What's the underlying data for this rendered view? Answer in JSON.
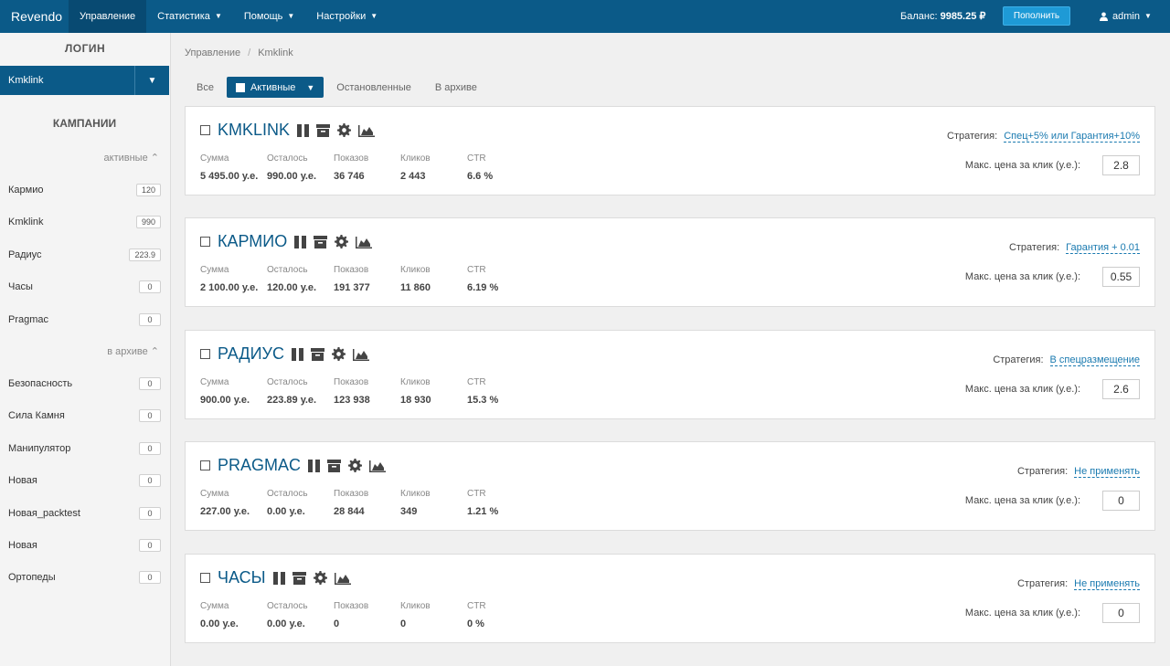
{
  "topbar": {
    "brand": "Revendo",
    "nav": [
      "Управление",
      "Статистика",
      "Помощь",
      "Настройки"
    ],
    "balance_label": "Баланс:",
    "balance_value": "9985.25 ₽",
    "topup_label": "Пополнить",
    "user": "admin"
  },
  "sidebar": {
    "login_heading": "ЛОГИН",
    "login_value": "Kmklink",
    "campaigns_heading": "КАМПАНИИ",
    "active_label": "активные",
    "archive_label": "в архиве",
    "active_items": [
      {
        "name": "Кармио",
        "count": "120"
      },
      {
        "name": "Kmklink",
        "count": "990"
      },
      {
        "name": "Радиус",
        "count": "223.9"
      },
      {
        "name": "Часы",
        "count": "0"
      },
      {
        "name": "Pragmac",
        "count": "0"
      }
    ],
    "archive_items": [
      {
        "name": "Безопасность",
        "count": "0"
      },
      {
        "name": "Сила Камня",
        "count": "0"
      },
      {
        "name": "Манипулятор",
        "count": "0"
      },
      {
        "name": "Новая",
        "count": "0"
      },
      {
        "name": "Новая_packtest",
        "count": "0"
      },
      {
        "name": "Новая",
        "count": "0"
      },
      {
        "name": "Ортопеды",
        "count": "0"
      }
    ]
  },
  "breadcrumb": [
    "Управление",
    "Kmklink"
  ],
  "filters": {
    "all": "Все",
    "active": "Активные",
    "stopped": "Остановленные",
    "archive": "В архиве"
  },
  "stat_labels": [
    "Сумма",
    "Осталось",
    "Показов",
    "Кликов",
    "CTR"
  ],
  "strategy_label": "Стратегия:",
  "maxprice_label": "Макс. цена за клик (у.е.):",
  "campaigns": [
    {
      "name": "KMKLINK",
      "stats": [
        "5 495.00 у.е.",
        "990.00 у.е.",
        "36 746",
        "2 443",
        "6.6 %"
      ],
      "strategy": "Спец+5% или Гарантия+10%",
      "price": "2.8"
    },
    {
      "name": "КАРМИО",
      "stats": [
        "2 100.00 у.е.",
        "120.00 у.е.",
        "191 377",
        "11 860",
        "6.19 %"
      ],
      "strategy": "Гарантия + 0.01",
      "price": "0.55"
    },
    {
      "name": "РАДИУС",
      "stats": [
        "900.00 у.е.",
        "223.89 у.е.",
        "123 938",
        "18 930",
        "15.3 %"
      ],
      "strategy": "В спецразмещение",
      "price": "2.6"
    },
    {
      "name": "PRAGMAC",
      "stats": [
        "227.00 у.е.",
        "0.00 у.е.",
        "28 844",
        "349",
        "1.21 %"
      ],
      "strategy": "Не применять",
      "price": "0"
    },
    {
      "name": "ЧАСЫ",
      "stats": [
        "0.00 у.е.",
        "0.00 у.е.",
        "0",
        "0",
        "0 %"
      ],
      "strategy": "Не применять",
      "price": "0"
    }
  ]
}
